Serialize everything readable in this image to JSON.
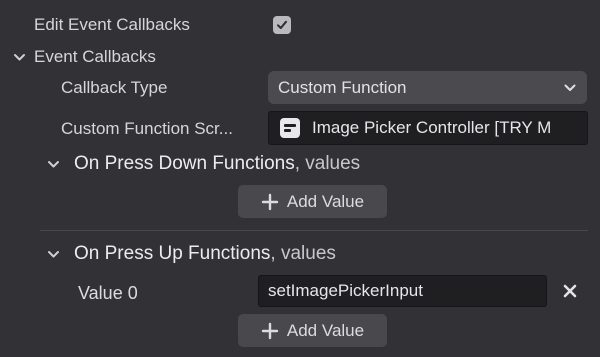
{
  "edit_event_callbacks": {
    "label": "Edit Event Callbacks",
    "checked": true
  },
  "event_callbacks": {
    "label": "Event Callbacks",
    "callback_type": {
      "label": "Callback Type",
      "value": "Custom Function"
    },
    "custom_function_script": {
      "label": "Custom Function Scr...",
      "value": "Image Picker Controller [TRY M"
    }
  },
  "press_down": {
    "title": "On Press Down Functions",
    "suffix": ", values",
    "add_label": "Add Value"
  },
  "press_up": {
    "title": "On Press Up Functions",
    "suffix": ", values",
    "value_label": "Value 0",
    "value": "setImagePickerInput",
    "add_label": "Add Value"
  },
  "icons": {
    "check": "checkmark-icon",
    "chevron": "chevron-down-icon",
    "script": "script-component-icon",
    "plus": "plus-icon",
    "remove": "close-icon"
  }
}
